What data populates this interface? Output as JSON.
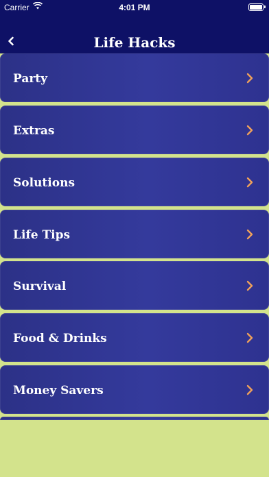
{
  "status_bar": {
    "carrier": "Carrier",
    "time": "4:01 PM"
  },
  "nav": {
    "title": "Life Hacks"
  },
  "menu": {
    "items": [
      {
        "label": "Party"
      },
      {
        "label": "Extras"
      },
      {
        "label": "Solutions"
      },
      {
        "label": "Life Tips"
      },
      {
        "label": "Survival"
      },
      {
        "label": "Food & Drinks"
      },
      {
        "label": "Money Savers"
      }
    ]
  },
  "colors": {
    "nav_background": "#0e1166",
    "row_background": "#2f3494",
    "page_background": "#d3e38c",
    "chevron": "#f0a25a"
  },
  "icons": {
    "back": "chevron-left-icon",
    "row_chevron": "chevron-right-icon",
    "wifi": "wifi-icon",
    "battery": "battery-icon"
  }
}
